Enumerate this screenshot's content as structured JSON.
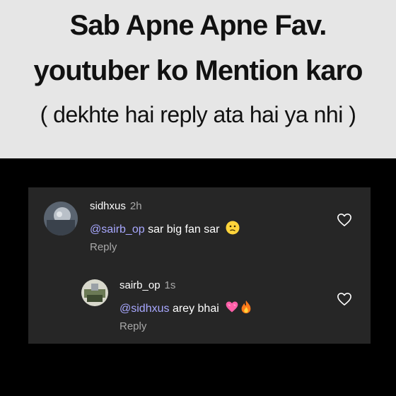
{
  "banner": {
    "line1": "Sab Apne Apne Fav.",
    "line2": "youtuber ko Mention karo",
    "line3": "( dekhte hai reply ata hai ya nhi )"
  },
  "comments": [
    {
      "username": "sidhxus",
      "time": "2h",
      "mention": "@sairb_op",
      "text": " sar big fan sar",
      "emoji": "confused-face",
      "reply_label": "Reply",
      "like_icon": "heart-outline-icon"
    },
    {
      "username": "sairb_op",
      "time": "1s",
      "mention": "@sidhxus",
      "text": " arey bhai",
      "emoji": [
        "pink-heart",
        "fire"
      ],
      "reply_label": "Reply",
      "like_icon": "heart-outline-icon"
    }
  ],
  "colors": {
    "banner_bg": "#e6e6e6",
    "panel_bg": "#262626",
    "mention": "#a8a8ff",
    "muted": "#a8a8a8"
  }
}
